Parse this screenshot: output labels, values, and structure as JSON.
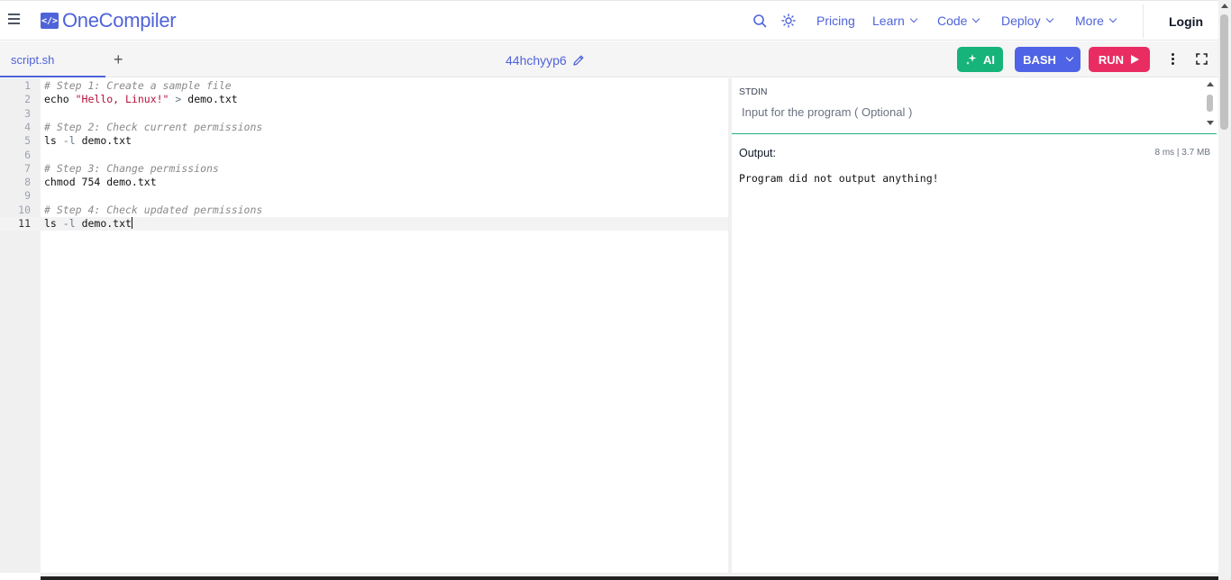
{
  "nav": {
    "logo_text": "OneCompiler",
    "logo_mark": "</>",
    "items": [
      {
        "label": "Pricing",
        "dropdown": false
      },
      {
        "label": "Learn",
        "dropdown": true
      },
      {
        "label": "Code",
        "dropdown": true
      },
      {
        "label": "Deploy",
        "dropdown": true
      },
      {
        "label": "More",
        "dropdown": true
      }
    ],
    "login_label": "Login",
    "icons": [
      "menu-icon",
      "search-icon",
      "theme-sun-icon"
    ],
    "accent": "#4f63d9"
  },
  "toolbar": {
    "file_tab": "script.sh",
    "add_tab": "+",
    "code_id": "44hchyyp6",
    "ai_label": "AI",
    "language_label": "BASH",
    "run_label": "RUN",
    "colors": {
      "ai": "#16b37a",
      "language": "#4f63e6",
      "run": "#e92d63"
    }
  },
  "editor": {
    "active_line": 11,
    "lines": [
      {
        "n": "1",
        "html": "<span class=\"comment\"># Step 1: Create a sample file</span>"
      },
      {
        "n": "2",
        "html": "echo <span class=\"string\">\"Hello, Linux!\"</span> <span class=\"op\">&gt;</span> demo.txt"
      },
      {
        "n": "3",
        "html": ""
      },
      {
        "n": "4",
        "html": "<span class=\"comment\"># Step 2: Check current permissions</span>"
      },
      {
        "n": "5",
        "html": "ls <span class=\"op\">-l</span> demo.txt"
      },
      {
        "n": "6",
        "html": ""
      },
      {
        "n": "7",
        "html": "<span class=\"comment\"># Step 3: Change permissions</span>"
      },
      {
        "n": "8",
        "html": "chmod 754 demo.txt"
      },
      {
        "n": "9",
        "html": ""
      },
      {
        "n": "10",
        "html": "<span class=\"comment\"># Step 4: Check updated permissions</span>"
      },
      {
        "n": "11",
        "html": "ls <span class=\"op\">-l</span> demo.txt<span class=\"cursor\"></span>"
      }
    ]
  },
  "stdin": {
    "label": "STDIN",
    "placeholder": "Input for the program ( Optional )"
  },
  "output": {
    "label": "Output:",
    "meta": "8 ms | 3.7 MB",
    "text": "Program did not output anything!"
  }
}
